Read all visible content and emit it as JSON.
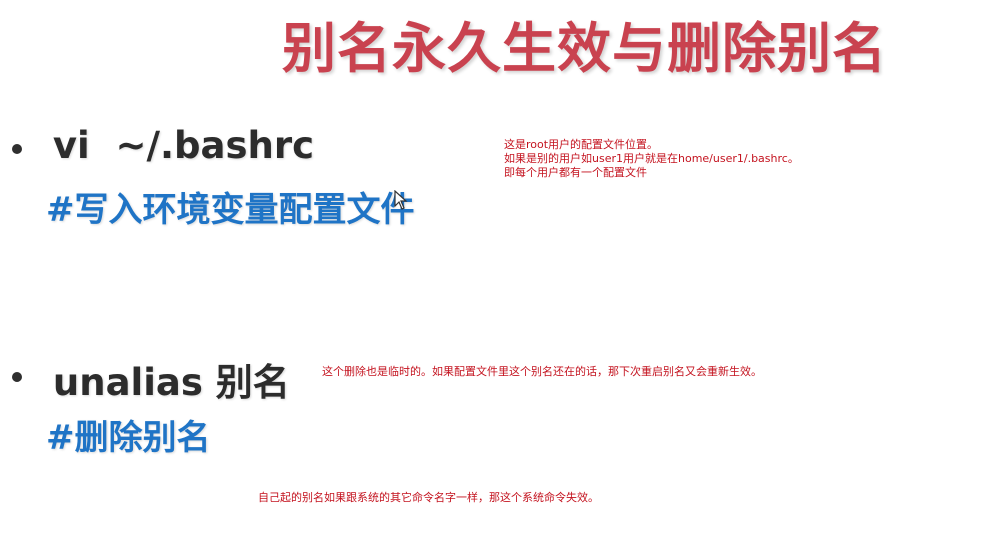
{
  "slide": {
    "title": "别名永久生效与删除别名"
  },
  "items": [
    {
      "command": " vi  ~/.bashrc",
      "comment": "#写入环境变量配置文件",
      "notes": [
        "这是root用户的配置文件位置。",
        "如果是别的用户如user1用户就是在home/user1/.bashrc。",
        "即每个用户都有一个配置文件"
      ]
    },
    {
      "command": " unalias 别名",
      "comment": "#删除别名",
      "notes": [
        "这个删除也是临时的。如果配置文件里这个别名还在的话，那下次重启别名又会重新生效。"
      ]
    }
  ],
  "bottom_note": "自己起的别名如果跟系统的其它命令名字一样，那这个系统命令失效。",
  "colors": {
    "title": "#c9424f",
    "comment": "#1f74c6",
    "note": "#c4131f",
    "command": "#2c2c2c"
  },
  "icons": {
    "cursor": "mouse-pointer-icon"
  }
}
